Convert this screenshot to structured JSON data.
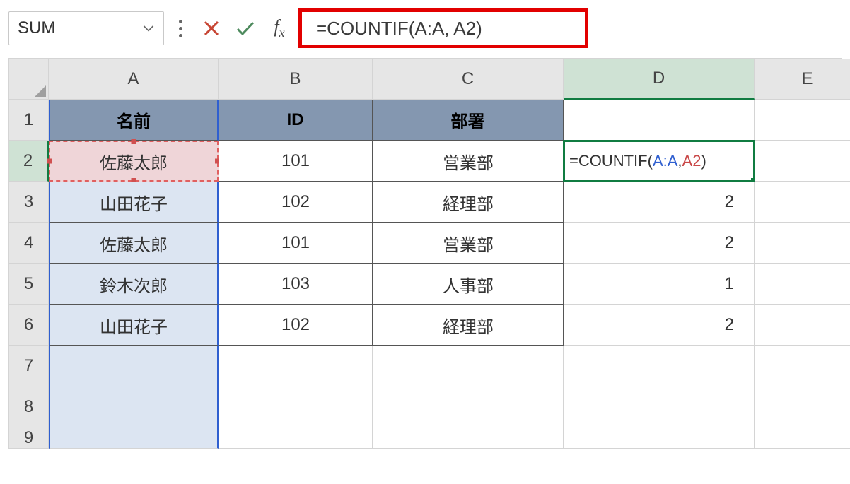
{
  "namebox": {
    "value": "SUM"
  },
  "formula_bar": {
    "formula_plain": "=COUNTIF(A:A, A2)"
  },
  "columns": [
    "A",
    "B",
    "C",
    "D",
    "E"
  ],
  "rows": [
    "1",
    "2",
    "3",
    "4",
    "5",
    "6",
    "7",
    "8",
    "9"
  ],
  "headers": {
    "A": "名前",
    "B": "ID",
    "C": "部署"
  },
  "data": [
    {
      "A": "佐藤太郎",
      "B": "101",
      "C": "営業部"
    },
    {
      "A": "山田花子",
      "B": "102",
      "C": "経理部",
      "D": "2"
    },
    {
      "A": "佐藤太郎",
      "B": "101",
      "C": "営業部",
      "D": "2"
    },
    {
      "A": "鈴木次郎",
      "B": "103",
      "C": "人事部",
      "D": "1"
    },
    {
      "A": "山田花子",
      "B": "102",
      "C": "経理部",
      "D": "2"
    }
  ],
  "editing_cell": {
    "pre": "=COUNTIF(",
    "range": "A:A",
    "mid": ", ",
    "ref": "A2",
    "post": ")"
  },
  "icons": {
    "cancel": "cancel-icon",
    "confirm": "confirm-icon",
    "fx": "fx-icon",
    "chevron": "chevron-down-icon"
  }
}
